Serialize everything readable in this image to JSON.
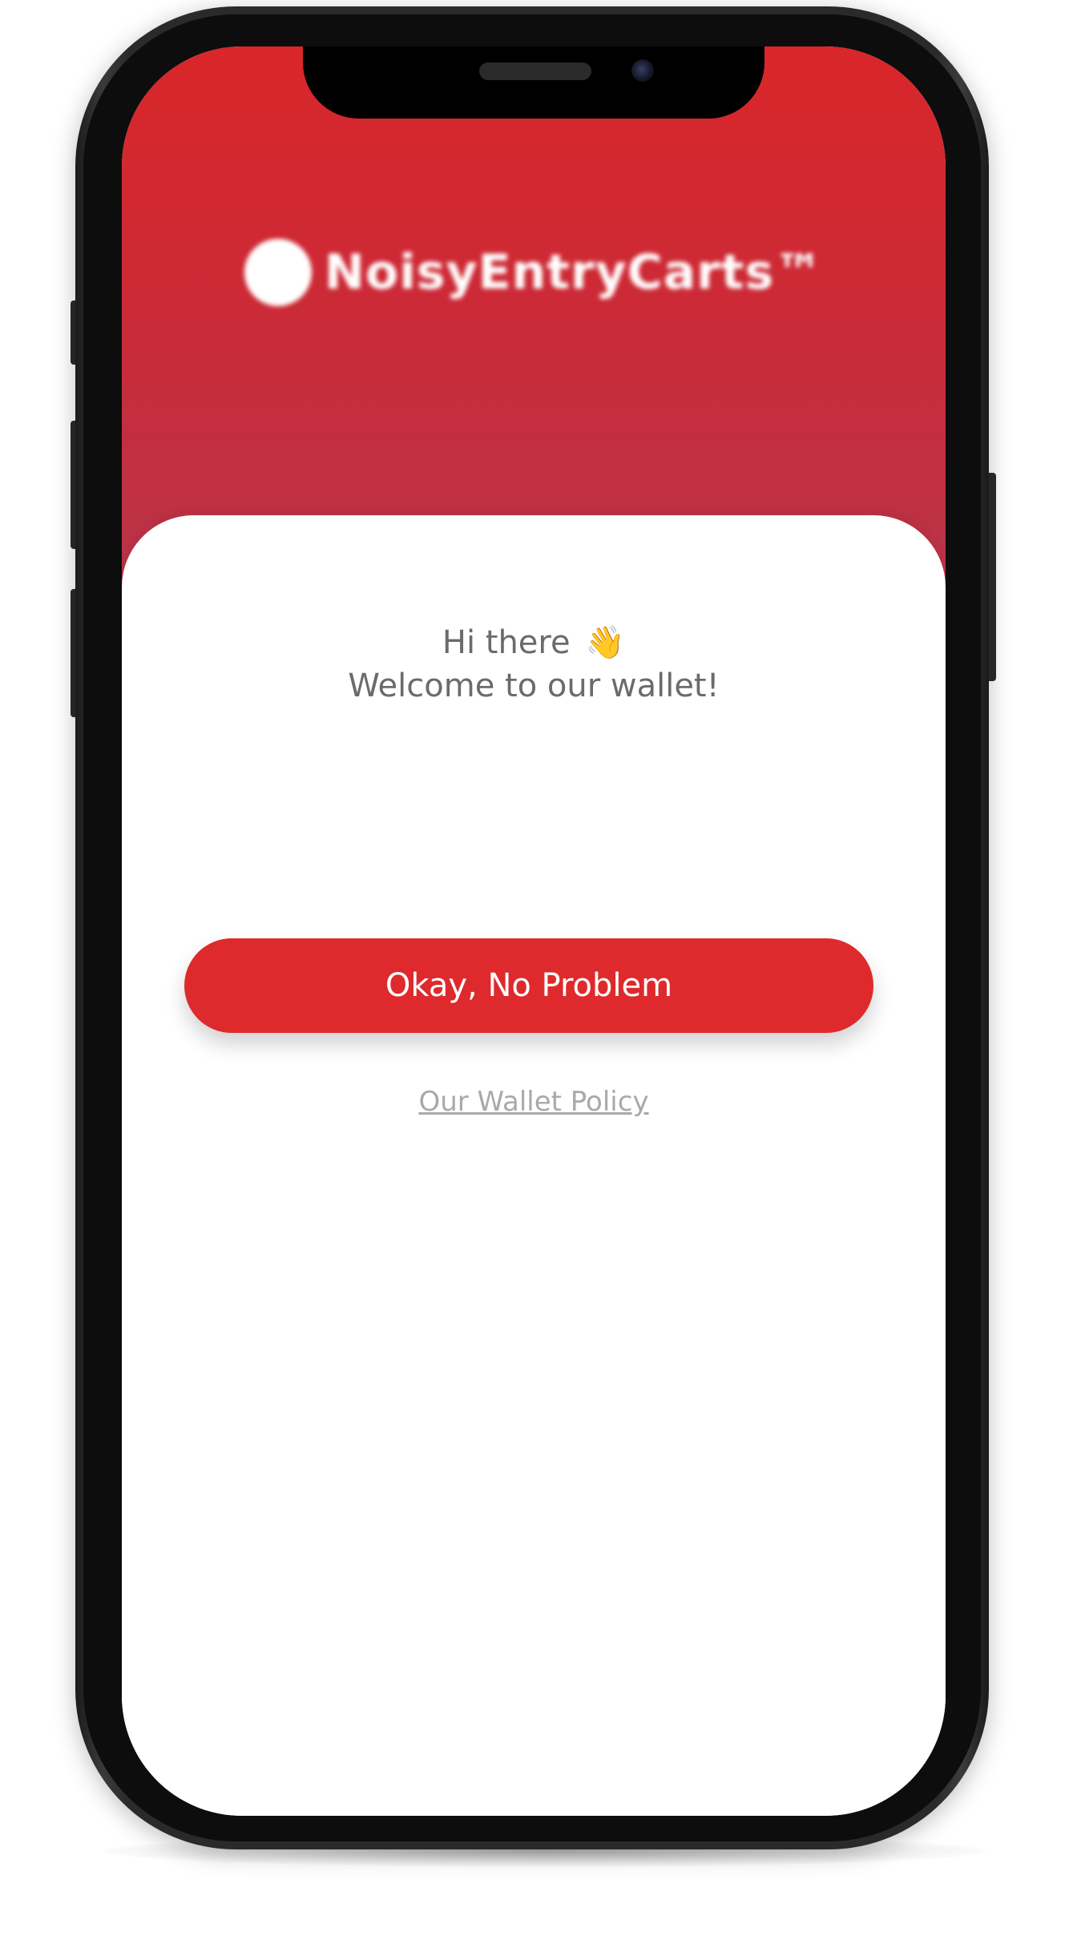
{
  "brand": {
    "name": "NoisyEntryCarts™",
    "logo_icon": "circle-logo-icon"
  },
  "welcome": {
    "line1": "Hi there",
    "wave_emoji": "👋",
    "line2": "Welcome to our wallet!"
  },
  "actions": {
    "primary_label": "Okay, No Problem",
    "policy_link": "Our Wallet Policy"
  },
  "colors": {
    "header_top": "#d9262a",
    "header_bottom": "#b8344a",
    "button": "#de2a2c",
    "text_gray": "#6b6b6b",
    "link_gray": "#a9a9a9"
  }
}
